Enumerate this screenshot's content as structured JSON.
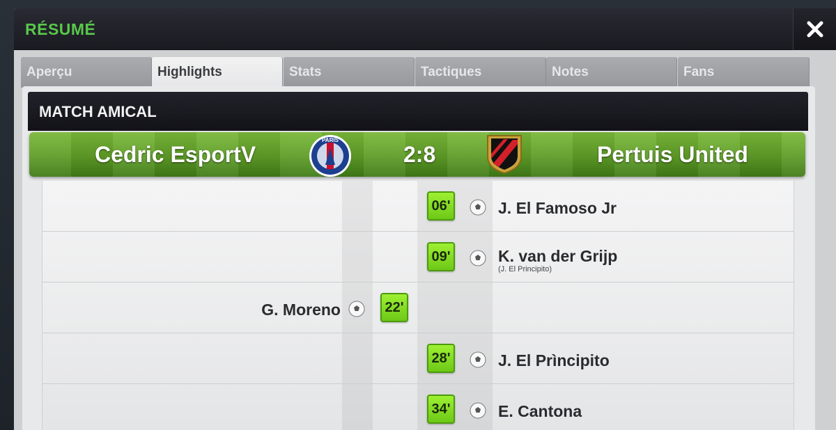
{
  "header": {
    "title": "RÉSUMÉ"
  },
  "tabs": [
    {
      "label": "Aperçu"
    },
    {
      "label": "Highlights"
    },
    {
      "label": "Stats"
    },
    {
      "label": "Tactiques"
    },
    {
      "label": "Notes"
    },
    {
      "label": "Fans"
    }
  ],
  "active_tab": "Highlights",
  "match": {
    "type": "MATCH AMICAL",
    "home_team": "Cedric EsportV",
    "away_team": "Pertuis United",
    "score": "2:8",
    "home_logo_text": "PARIS"
  },
  "events": [
    {
      "minute": "06'",
      "player": "J. El Famoso Jr",
      "side": "away",
      "assist": ""
    },
    {
      "minute": "09'",
      "player": "K. van der Grijp",
      "side": "away",
      "assist": "(J. El Principito)"
    },
    {
      "minute": "22'",
      "player": "G. Moreno",
      "side": "home",
      "assist": ""
    },
    {
      "minute": "28'",
      "player": "J. El Prìncipito",
      "side": "away",
      "assist": ""
    },
    {
      "minute": "34'",
      "player": "E. Cantona",
      "side": "away",
      "assist": ""
    }
  ],
  "colors": {
    "title_green": "#58c84a",
    "minute_green": "#8ae626",
    "pitch_green": "#5e9c27"
  }
}
